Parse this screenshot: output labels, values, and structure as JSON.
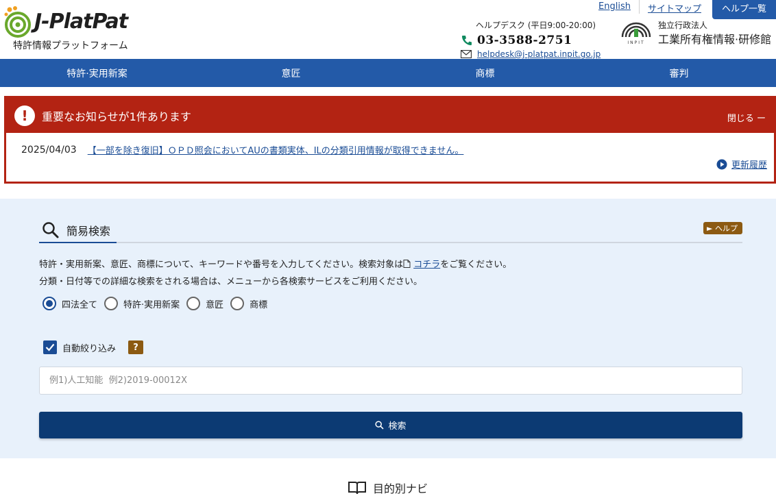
{
  "header": {
    "logo_text": "J-PlatPat",
    "logo_sub": "特許情報プラットフォーム",
    "links": [
      "English",
      "サイトマップ"
    ],
    "help_tab": "ヘルプ一覧",
    "helpdesk_title": "ヘルプデスク (平日9:00-20:00)",
    "phone": "03-3588-2751",
    "email": "helpdesk@j-platpat.inpit.go.jp",
    "inpit_line1": "独立行政法人",
    "inpit_line2": "工業所有権情報·研修館",
    "inpit_logo_text": "INPIT"
  },
  "nav": [
    "特許·実用新案",
    "意匠",
    "商標",
    "審判"
  ],
  "notice": {
    "title": "重要なお知らせが1件あります",
    "close_label": "閉じる ー",
    "date": "2025/04/03",
    "link": "【一部を除き復旧】ＯＰＤ照会においてAUの書類実体、ILの分類引用情報が取得できません。",
    "history": "更新履歴"
  },
  "search": {
    "title": "簡易検索",
    "help": "► ヘルプ",
    "desc_line1_pre": "特許・実用新案、意匠、商標について、キーワードや番号を入力してください。検索対象は",
    "desc_link": "コチラ",
    "desc_line1_post": "をご覧ください。",
    "desc_line2": "分類・日付等での詳細な検索をされる場合は、メニューから各検索サービスをご利用ください。",
    "radios": [
      "四法全て",
      "特許·実用新案",
      "意匠",
      "商標"
    ],
    "selected_radio": "四法全て",
    "auto_filter": "自動絞り込み",
    "auto_filter_checked": true,
    "q_badge": "?",
    "placeholder": "例1)人工知能  例2)2019-00012X",
    "value": "",
    "button": "検索"
  },
  "footer_peek": "目的別ナビ",
  "colors": {
    "nav": "#235aa8",
    "notice": "#b32313",
    "search_bg": "#e8f1fb",
    "search_button": "#0c3a73",
    "help_badge": "#8c5a12"
  }
}
